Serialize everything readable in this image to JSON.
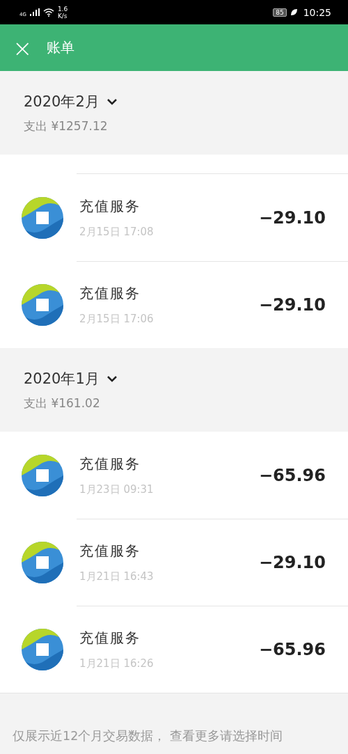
{
  "status_bar": {
    "network": "4G",
    "speed": [
      "1.6",
      "K/s"
    ],
    "battery": "85",
    "time": "10:25"
  },
  "header": {
    "close": "×",
    "title": "账单"
  },
  "months": [
    {
      "title": "2020年2月",
      "summary": "支出 ¥1257.12",
      "rows": [
        {
          "name": "充值服务",
          "time": "2月15日 17:08",
          "amount": "−29.10"
        },
        {
          "name": "充值服务",
          "time": "2月15日 17:06",
          "amount": "−29.10"
        }
      ]
    },
    {
      "title": "2020年1月",
      "summary": "支出 ¥161.02",
      "rows": [
        {
          "name": "充值服务",
          "time": "1月23日 09:31",
          "amount": "−65.96"
        },
        {
          "name": "充值服务",
          "time": "1月21日 16:43",
          "amount": "−29.10"
        },
        {
          "name": "充值服务",
          "time": "1月21日 16:26",
          "amount": "−65.96"
        }
      ]
    }
  ],
  "footer": "仅展示近12个月交易数据， 查看更多请选择时间"
}
